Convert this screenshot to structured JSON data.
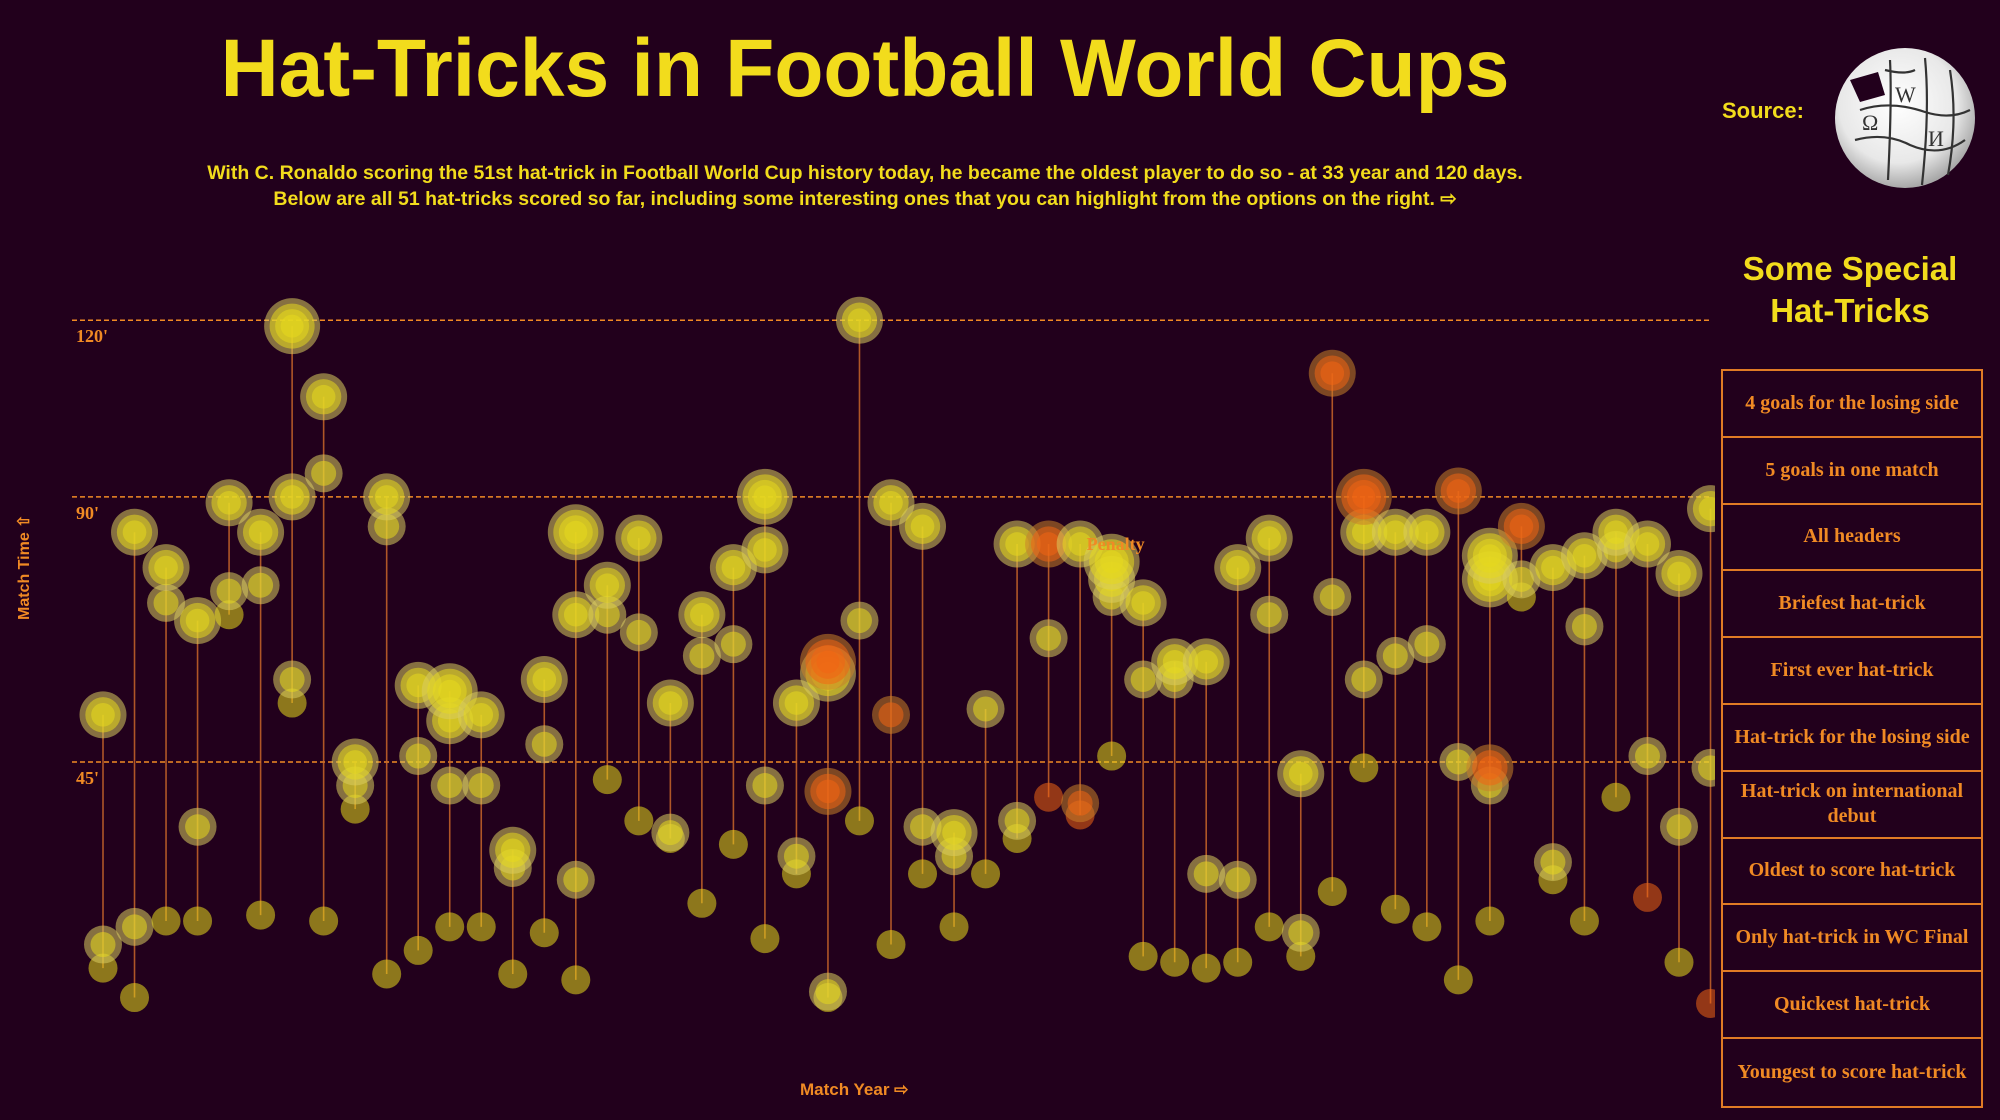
{
  "header": {
    "title": "Hat-Tricks in Football World Cups",
    "subtitle_line1": "With C. Ronaldo scoring the 51st hat-trick in Football World Cup history today, he became the oldest player to do so - at 33 year and 120 days.",
    "subtitle_line2": "Below are all 51 hat-tricks scored so far, including some interesting ones that you can highlight from the options on the right. ⇨",
    "source_label": "Source:",
    "source_icon": "wikipedia-globe-icon"
  },
  "panel": {
    "title_line1": "Some Special",
    "title_line2": "Hat-Tricks",
    "options": [
      "4 goals for the losing side",
      "5 goals in one match",
      "All headers",
      "Briefest hat-trick",
      "First ever hat-trick",
      "Hat-trick for the losing side",
      "Hat-trick on international debut",
      "Oldest to score hat-trick",
      "Only hat-trick in WC Final",
      "Quickest hat-trick",
      "Youngest to score hat-trick"
    ]
  },
  "colors": {
    "background": "#22001c",
    "title": "#f2dc1c",
    "accent": "#f08a24",
    "goal": "#e6d81e",
    "penalty": "#f06414"
  },
  "chart_data": {
    "type": "scatter",
    "title": "Hat-Tricks in Football World Cups",
    "xlabel": "Match Year ⇨",
    "ylabel": "Match Time ⇧",
    "y_ticks": [
      "45'",
      "90'",
      "120'"
    ],
    "y_tick_values": [
      45,
      90,
      120
    ],
    "ylim": [
      0,
      120
    ],
    "grid": "dashed horizontal at 45, 90, 120",
    "annotation": "Penalty",
    "annotation_target": {
      "hat_trick_index": 30,
      "goal_index": 3
    },
    "goal_types": [
      "goal",
      "penalty"
    ],
    "hat_tricks": [
      {
        "goals": [
          {
            "m": 10,
            "t": "goal"
          },
          {
            "m": 14,
            "t": "goal"
          },
          {
            "m": 53,
            "t": "goal"
          }
        ]
      },
      {
        "goals": [
          {
            "m": 5,
            "t": "goal"
          },
          {
            "m": 17,
            "t": "goal"
          },
          {
            "m": 84,
            "t": "goal"
          }
        ]
      },
      {
        "goals": [
          {
            "m": 18,
            "t": "goal"
          },
          {
            "m": 72,
            "t": "goal"
          },
          {
            "m": 78,
            "t": "goal"
          }
        ]
      },
      {
        "goals": [
          {
            "m": 18,
            "t": "goal"
          },
          {
            "m": 34,
            "t": "goal"
          },
          {
            "m": 69,
            "t": "goal"
          }
        ]
      },
      {
        "goals": [
          {
            "m": 70,
            "t": "goal"
          },
          {
            "m": 74,
            "t": "goal"
          },
          {
            "m": 89,
            "t": "goal"
          }
        ]
      },
      {
        "goals": [
          {
            "m": 19,
            "t": "goal"
          },
          {
            "m": 75,
            "t": "goal"
          },
          {
            "m": 84,
            "t": "goal"
          }
        ]
      },
      {
        "goals": [
          {
            "m": 55,
            "t": "goal"
          },
          {
            "m": 59,
            "t": "goal"
          },
          {
            "m": 90,
            "t": "goal"
          },
          {
            "m": 119,
            "t": "goal"
          }
        ]
      },
      {
        "goals": [
          {
            "m": 18,
            "t": "goal"
          },
          {
            "m": 94,
            "t": "goal"
          },
          {
            "m": 107,
            "t": "goal"
          }
        ]
      },
      {
        "goals": [
          {
            "m": 37,
            "t": "goal"
          },
          {
            "m": 41,
            "t": "goal"
          },
          {
            "m": 45,
            "t": "goal"
          }
        ]
      },
      {
        "goals": [
          {
            "m": 9,
            "t": "goal"
          },
          {
            "m": 85,
            "t": "goal"
          },
          {
            "m": 90,
            "t": "goal"
          }
        ]
      },
      {
        "goals": [
          {
            "m": 13,
            "t": "goal"
          },
          {
            "m": 46,
            "t": "goal"
          },
          {
            "m": 58,
            "t": "goal"
          }
        ]
      },
      {
        "goals": [
          {
            "m": 17,
            "t": "goal"
          },
          {
            "m": 41,
            "t": "goal"
          },
          {
            "m": 52,
            "t": "goal"
          },
          {
            "m": 57,
            "t": "goal"
          }
        ]
      },
      {
        "goals": [
          {
            "m": 17,
            "t": "goal"
          },
          {
            "m": 41,
            "t": "goal"
          },
          {
            "m": 53,
            "t": "goal"
          }
        ]
      },
      {
        "goals": [
          {
            "m": 9,
            "t": "goal"
          },
          {
            "m": 27,
            "t": "goal"
          },
          {
            "m": 30,
            "t": "goal"
          }
        ]
      },
      {
        "goals": [
          {
            "m": 16,
            "t": "goal"
          },
          {
            "m": 48,
            "t": "goal"
          },
          {
            "m": 59,
            "t": "goal"
          }
        ]
      },
      {
        "goals": [
          {
            "m": 8,
            "t": "goal"
          },
          {
            "m": 25,
            "t": "goal"
          },
          {
            "m": 70,
            "t": "goal"
          },
          {
            "m": 84,
            "t": "goal"
          }
        ]
      },
      {
        "goals": [
          {
            "m": 42,
            "t": "goal"
          },
          {
            "m": 70,
            "t": "goal"
          },
          {
            "m": 75,
            "t": "goal"
          }
        ]
      },
      {
        "goals": [
          {
            "m": 35,
            "t": "goal"
          },
          {
            "m": 67,
            "t": "goal"
          },
          {
            "m": 83,
            "t": "goal"
          }
        ]
      },
      {
        "goals": [
          {
            "m": 32,
            "t": "goal"
          },
          {
            "m": 33,
            "t": "goal"
          },
          {
            "m": 55,
            "t": "goal"
          }
        ]
      },
      {
        "goals": [
          {
            "m": 21,
            "t": "goal"
          },
          {
            "m": 63,
            "t": "goal"
          },
          {
            "m": 70,
            "t": "goal"
          }
        ]
      },
      {
        "goals": [
          {
            "m": 31,
            "t": "goal"
          },
          {
            "m": 65,
            "t": "goal"
          },
          {
            "m": 78,
            "t": "goal"
          }
        ]
      },
      {
        "goals": [
          {
            "m": 15,
            "t": "goal"
          },
          {
            "m": 41,
            "t": "goal"
          },
          {
            "m": 81,
            "t": "goal"
          },
          {
            "m": 90,
            "t": "goal"
          }
        ]
      },
      {
        "goals": [
          {
            "m": 26,
            "t": "goal"
          },
          {
            "m": 29,
            "t": "goal"
          },
          {
            "m": 55,
            "t": "goal"
          }
        ]
      },
      {
        "goals": [
          {
            "m": 5,
            "t": "goal"
          },
          {
            "m": 6,
            "t": "goal"
          },
          {
            "m": 40,
            "t": "penalty"
          },
          {
            "m": 60,
            "t": "goal"
          },
          {
            "m": 62,
            "t": "penalty"
          }
        ]
      },
      {
        "goals": [
          {
            "m": 35,
            "t": "goal"
          },
          {
            "m": 69,
            "t": "goal"
          },
          {
            "m": 120,
            "t": "goal"
          }
        ]
      },
      {
        "goals": [
          {
            "m": 14,
            "t": "goal"
          },
          {
            "m": 53,
            "t": "penalty"
          },
          {
            "m": 89,
            "t": "goal"
          }
        ]
      },
      {
        "goals": [
          {
            "m": 26,
            "t": "goal"
          },
          {
            "m": 34,
            "t": "goal"
          },
          {
            "m": 85,
            "t": "goal"
          }
        ]
      },
      {
        "goals": [
          {
            "m": 17,
            "t": "goal"
          },
          {
            "m": 29,
            "t": "goal"
          },
          {
            "m": 33,
            "t": "goal"
          }
        ]
      },
      {
        "goals": [
          {
            "m": 26,
            "t": "goal"
          },
          {
            "m": 54,
            "t": "goal"
          }
        ]
      },
      {
        "goals": [
          {
            "m": 32,
            "t": "goal"
          },
          {
            "m": 35,
            "t": "goal"
          },
          {
            "m": 82,
            "t": "goal"
          }
        ]
      },
      {
        "goals": [
          {
            "m": 39,
            "t": "penalty"
          },
          {
            "m": 66,
            "t": "goal"
          },
          {
            "m": 82,
            "t": "penalty"
          }
        ]
      },
      {
        "goals": [
          {
            "m": 36,
            "t": "penalty"
          },
          {
            "m": 38,
            "t": "penalty"
          },
          {
            "m": 82,
            "t": "goal"
          }
        ]
      },
      {
        "goals": [
          {
            "m": 46,
            "t": "goal"
          },
          {
            "m": 73,
            "t": "goal"
          },
          {
            "m": 76,
            "t": "goal"
          },
          {
            "m": 79,
            "t": "goal"
          }
        ]
      },
      {
        "goals": [
          {
            "m": 12,
            "t": "goal"
          },
          {
            "m": 59,
            "t": "goal"
          },
          {
            "m": 72,
            "t": "goal"
          }
        ]
      },
      {
        "goals": [
          {
            "m": 11,
            "t": "goal"
          },
          {
            "m": 59,
            "t": "goal"
          },
          {
            "m": 62,
            "t": "goal"
          }
        ]
      },
      {
        "goals": [
          {
            "m": 10,
            "t": "goal"
          },
          {
            "m": 26,
            "t": "goal"
          },
          {
            "m": 62,
            "t": "goal"
          }
        ]
      },
      {
        "goals": [
          {
            "m": 11,
            "t": "goal"
          },
          {
            "m": 25,
            "t": "goal"
          },
          {
            "m": 78,
            "t": "goal"
          }
        ]
      },
      {
        "goals": [
          {
            "m": 17,
            "t": "goal"
          },
          {
            "m": 70,
            "t": "goal"
          },
          {
            "m": 83,
            "t": "goal"
          }
        ]
      },
      {
        "goals": [
          {
            "m": 12,
            "t": "goal"
          },
          {
            "m": 16,
            "t": "goal"
          },
          {
            "m": 43,
            "t": "goal"
          }
        ]
      },
      {
        "goals": [
          {
            "m": 23,
            "t": "goal"
          },
          {
            "m": 73,
            "t": "goal"
          },
          {
            "m": 111,
            "t": "penalty"
          }
        ]
      },
      {
        "goals": [
          {
            "m": 44,
            "t": "goal"
          },
          {
            "m": 59,
            "t": "goal"
          },
          {
            "m": 84,
            "t": "goal"
          },
          {
            "m": 90,
            "t": "penalty"
          }
        ]
      },
      {
        "goals": [
          {
            "m": 20,
            "t": "goal"
          },
          {
            "m": 63,
            "t": "goal"
          },
          {
            "m": 84,
            "t": "goal"
          }
        ]
      },
      {
        "goals": [
          {
            "m": 17,
            "t": "goal"
          },
          {
            "m": 65,
            "t": "goal"
          },
          {
            "m": 84,
            "t": "goal"
          }
        ]
      },
      {
        "goals": [
          {
            "m": 8,
            "t": "goal"
          },
          {
            "m": 45,
            "t": "goal"
          },
          {
            "m": 91,
            "t": "penalty"
          }
        ]
      },
      {
        "goals": [
          {
            "m": 18,
            "t": "goal"
          },
          {
            "m": 41,
            "t": "goal"
          },
          {
            "m": 44,
            "t": "penalty"
          },
          {
            "m": 76,
            "t": "goal"
          },
          {
            "m": 80,
            "t": "goal"
          }
        ]
      },
      {
        "goals": [
          {
            "m": 73,
            "t": "goal"
          },
          {
            "m": 76,
            "t": "goal"
          },
          {
            "m": 85,
            "t": "penalty"
          }
        ]
      },
      {
        "goals": [
          {
            "m": 25,
            "t": "goal"
          },
          {
            "m": 28,
            "t": "goal"
          },
          {
            "m": 78,
            "t": "goal"
          }
        ]
      },
      {
        "goals": [
          {
            "m": 18,
            "t": "goal"
          },
          {
            "m": 68,
            "t": "goal"
          },
          {
            "m": 80,
            "t": "goal"
          }
        ]
      },
      {
        "goals": [
          {
            "m": 39,
            "t": "goal"
          },
          {
            "m": 81,
            "t": "goal"
          },
          {
            "m": 84,
            "t": "goal"
          }
        ]
      },
      {
        "goals": [
          {
            "m": 22,
            "t": "penalty"
          },
          {
            "m": 46,
            "t": "goal"
          },
          {
            "m": 82,
            "t": "goal"
          }
        ]
      },
      {
        "goals": [
          {
            "m": 11,
            "t": "goal"
          },
          {
            "m": 34,
            "t": "goal"
          },
          {
            "m": 77,
            "t": "goal"
          }
        ]
      },
      {
        "goals": [
          {
            "m": 4,
            "t": "penalty"
          },
          {
            "m": 44,
            "t": "goal"
          },
          {
            "m": 88,
            "t": "goal"
          }
        ]
      }
    ]
  }
}
